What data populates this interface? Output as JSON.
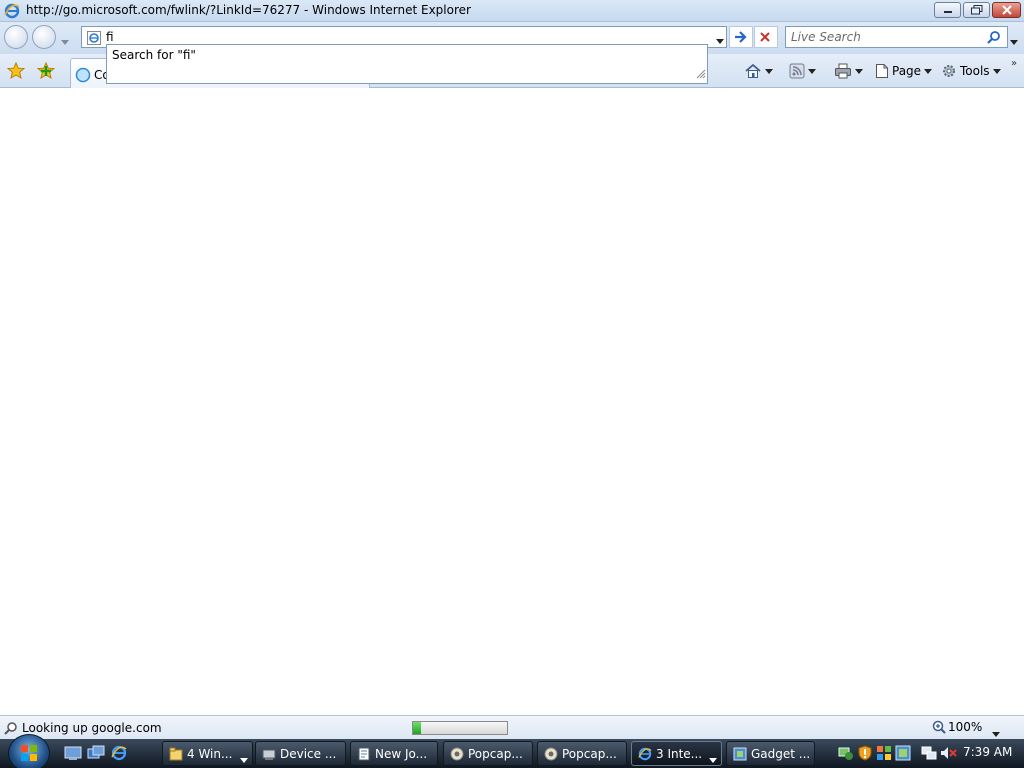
{
  "window": {
    "title": "http://go.microsoft.com/fwlink/?LinkId=76277 - Windows Internet Explorer"
  },
  "address_bar": {
    "value": "fi",
    "autocomplete_suggestion": "Search for \"fi\""
  },
  "search_box": {
    "placeholder": "Live Search"
  },
  "tab": {
    "label": "Co"
  },
  "toolbar": {
    "page_label": "Page",
    "tools_label": "Tools"
  },
  "status_bar": {
    "text": "Looking up google.com",
    "progress": 0.08,
    "zoom": "100%"
  },
  "taskbar": {
    "items": [
      {
        "label": "4 Win...",
        "icon": "folder-icon",
        "has_dropdown": true
      },
      {
        "label": "Device ...",
        "icon": "device-manager-icon",
        "has_dropdown": false
      },
      {
        "label": "New Jo...",
        "icon": "notepad-icon",
        "has_dropdown": false
      },
      {
        "label": "Popcap...",
        "icon": "popcap-icon",
        "has_dropdown": false
      },
      {
        "label": "Popcap...",
        "icon": "popcap-icon",
        "has_dropdown": false
      },
      {
        "label": "3 Inte...",
        "icon": "ie-icon",
        "has_dropdown": true
      },
      {
        "label": "Gadget ...",
        "icon": "gadget-icon",
        "has_dropdown": false
      }
    ],
    "clock": "7:39 AM"
  },
  "colors": {
    "accent": "#1f6fd1",
    "progress_fill": "#1ea51e",
    "close_button": "#c0473a"
  }
}
